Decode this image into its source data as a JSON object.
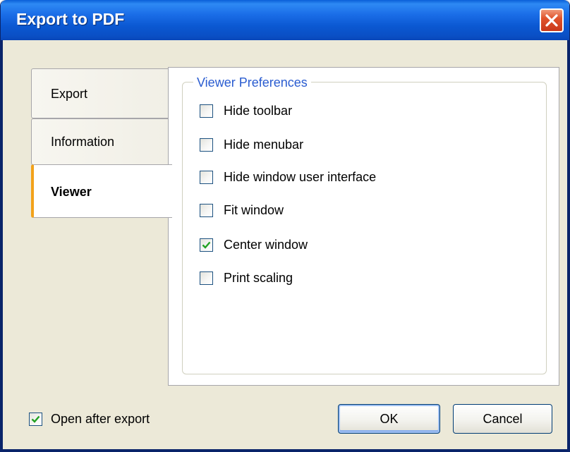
{
  "window": {
    "title": "Export to PDF",
    "close_icon": "close-icon"
  },
  "tabs": [
    {
      "label": "Export",
      "selected": false
    },
    {
      "label": "Information",
      "selected": false
    },
    {
      "label": "Viewer",
      "selected": true
    }
  ],
  "viewer": {
    "group_title": "Viewer Preferences",
    "options": [
      {
        "label": "Hide toolbar",
        "checked": false
      },
      {
        "label": "Hide menubar",
        "checked": false
      },
      {
        "label": "Hide window user interface",
        "checked": false
      },
      {
        "label": "Fit window",
        "checked": false
      },
      {
        "label": "Center window",
        "checked": true
      },
      {
        "label": "Print scaling",
        "checked": false
      }
    ]
  },
  "footer": {
    "open_after_export": {
      "label": "Open after export",
      "checked": true
    },
    "ok_label": "OK",
    "cancel_label": "Cancel"
  },
  "colors": {
    "titlebar": "#0a5fd8",
    "selected_tab_accent": "#f2a21a",
    "group_title": "#2a5cd0",
    "checkmark": "#21a121"
  }
}
